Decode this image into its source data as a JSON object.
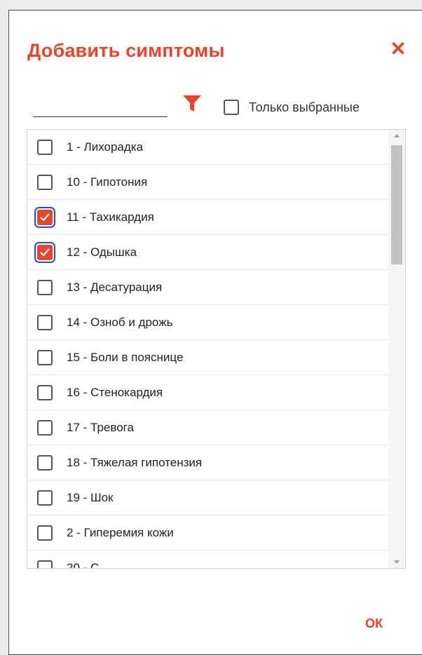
{
  "dialog": {
    "title": "Добавить симптомы",
    "close_label": "✕",
    "ok_label": "ОК"
  },
  "filter": {
    "search_value": "",
    "only_selected_label": "Только выбранные",
    "only_selected_checked": false
  },
  "colors": {
    "accent": "#e8452c",
    "focus": "#1f4fe0"
  },
  "symptoms": [
    {
      "label": "1 - Лихорадка",
      "checked": false
    },
    {
      "label": "10 - Гипотония",
      "checked": false
    },
    {
      "label": "11 - Тахикардия",
      "checked": true
    },
    {
      "label": "12 - Одышка",
      "checked": true
    },
    {
      "label": "13 - Десатурация",
      "checked": false
    },
    {
      "label": "14 - Озноб и дрожь",
      "checked": false
    },
    {
      "label": "15 - Боли в пояснице",
      "checked": false
    },
    {
      "label": "16 - Стенокардия",
      "checked": false
    },
    {
      "label": "17 - Тревога",
      "checked": false
    },
    {
      "label": "18 - Тяжелая гипотензия",
      "checked": false
    },
    {
      "label": "19 - Шок",
      "checked": false
    },
    {
      "label": "2 - Гиперемия кожи",
      "checked": false
    },
    {
      "label": "20 - С...",
      "checked": false
    }
  ]
}
